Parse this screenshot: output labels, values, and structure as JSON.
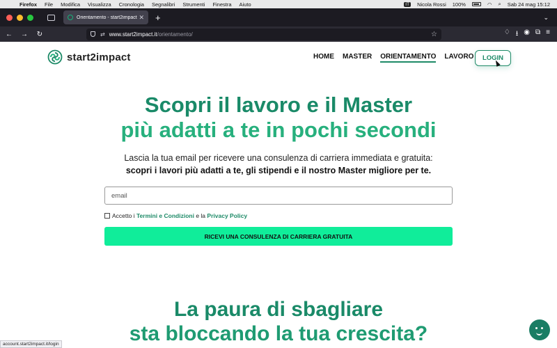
{
  "macos": {
    "menu": [
      "Firefox",
      "File",
      "Modifica",
      "Visualizza",
      "Cronologia",
      "Segnalibri",
      "Strumenti",
      "Finestra",
      "Aiuto"
    ],
    "input_source": "IT",
    "user": "Nicola Rossi",
    "battery": "100%",
    "datetime": "Sab 24 mag  15:12"
  },
  "browser": {
    "tab_title": "Orientamento - start2impact",
    "url_host": "www.start2impact.it",
    "url_path": "/orientamento/",
    "new_tab": "+",
    "close_tab": "✕"
  },
  "site": {
    "brand": "start2impact",
    "nav": [
      "HOME",
      "MASTER",
      "ORIENTAMENTO",
      "LAVORO"
    ],
    "login": "LOGIN",
    "hero_title_line1": "Scopri il lavoro e il Master",
    "hero_title_line2": "più adatti a te in pochi secondi",
    "hero_sub_line1": "Lascia la tua email per ricevere una consulenza di carriera immediata e gratuita:",
    "hero_sub_line2": "scopri i lavori più adatti a te, gli stipendi e il nostro Master migliore per te.",
    "email_placeholder": "email",
    "consent_prefix": "Accetto i",
    "consent_terms": "Termini e Condizioni",
    "consent_and": "e la",
    "consent_privacy": "Privacy Policy",
    "cta": "RICEVI UNA CONSULENZA DI CARRIERA GRATUITA",
    "section_title_line1": "La paura di sbagliare",
    "section_title_line2": "sta bloccando la tua crescita?"
  },
  "status_url": "account.start2impact.it/login",
  "colors": {
    "accent": "#1d8a67",
    "cta": "#10ed9a",
    "chat": "#1a7d64"
  }
}
